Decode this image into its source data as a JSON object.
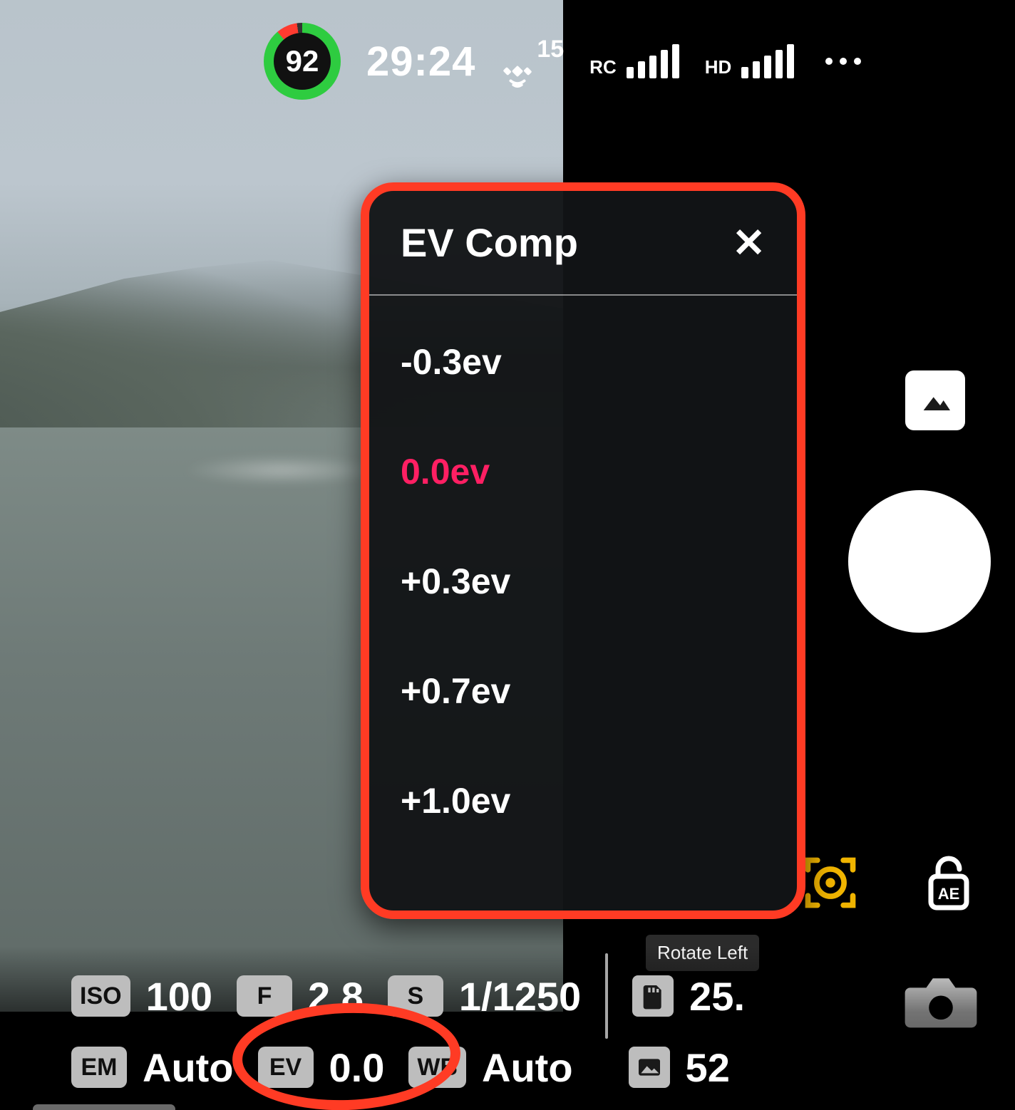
{
  "status": {
    "battery_percent": "92",
    "flight_time": "29:24",
    "satellites": "15",
    "rc_label": "RC",
    "hd_label": "HD"
  },
  "ev_popup": {
    "title": "EV Comp",
    "options": [
      "-0.3ev",
      "0.0ev",
      "+0.3ev",
      "+0.7ev",
      "+1.0ev"
    ],
    "selected": "0.0ev"
  },
  "tooltip": {
    "rotate_left": "Rotate Left"
  },
  "params": {
    "iso_label": "ISO",
    "iso_value": "100",
    "f_label": "F",
    "f_value": "2.8",
    "s_label": "S",
    "s_value": "1/1250",
    "em_label": "EM",
    "em_value": "Auto",
    "ev_label": "EV",
    "ev_value": "0.0",
    "wb_label": "WB",
    "wb_value": "Auto",
    "storage_remaining": "25.",
    "photos_remaining": "52"
  },
  "icons": {
    "satellite": "satellite-icon",
    "more": "more-icon",
    "gallery": "gallery-icon",
    "shutter": "shutter-button",
    "focus": "focus-icon",
    "ae_lock": "ae-lock-icon",
    "camera": "camera-icon",
    "sd": "sd-card-icon",
    "photo_count": "photo-count-icon",
    "close": "close-icon"
  }
}
